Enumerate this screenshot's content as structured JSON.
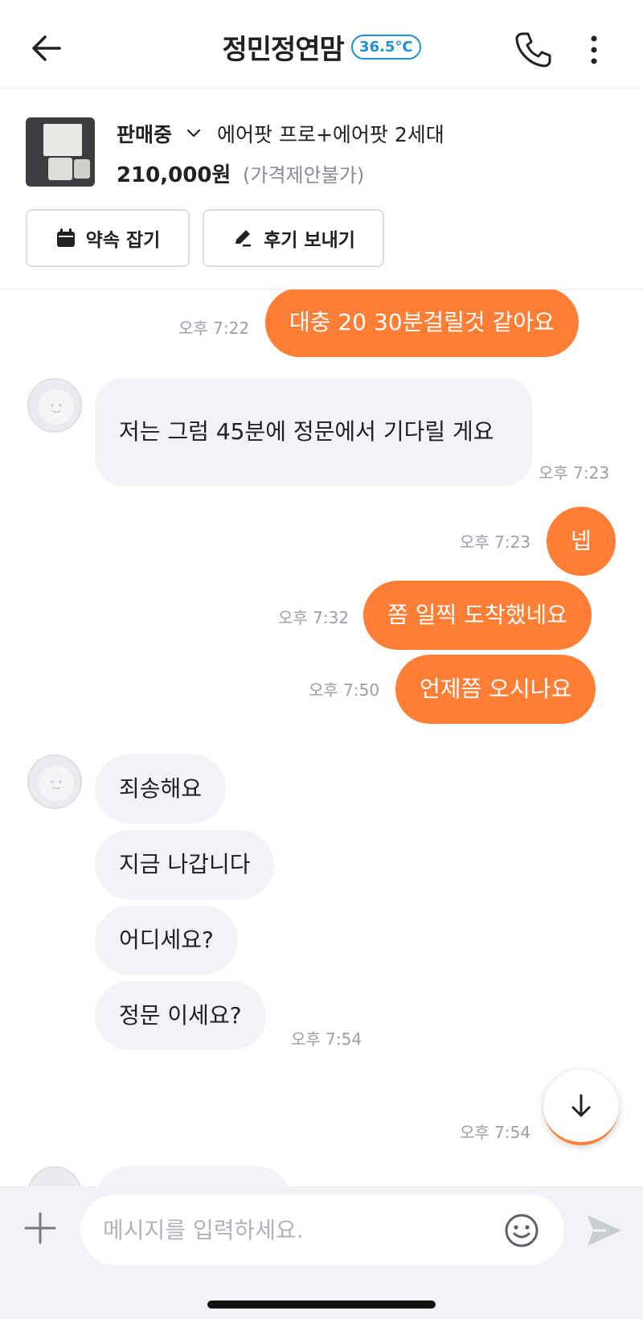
{
  "header": {
    "title": "정민정연맘",
    "temperature": "36.5°C",
    "icons": {
      "back": "back-arrow-icon",
      "phone": "phone-icon",
      "more": "more-vertical-icon"
    }
  },
  "product": {
    "status": "판매중",
    "title": "에어팟 프로+에어팟 2세대",
    "price": "210,000원",
    "price_note": "(가격제안불가)",
    "appointment_label": "약속 잡기",
    "review_label": "후기 보내기"
  },
  "messages": [
    {
      "from": "me",
      "text": "대충 20 30분걸릴것 같아요",
      "time": "오후 7:22"
    },
    {
      "from": "them",
      "text": "저는 그럼 45분에 정문에서 기다릴 게요",
      "time": "오후 7:23"
    },
    {
      "from": "me",
      "text": "넵",
      "time": "오후 7:23"
    },
    {
      "from": "me",
      "text": "쫌 일찍 도착했네요",
      "time": "오후 7:32"
    },
    {
      "from": "me",
      "text": "언제쯤 오시나요",
      "time": "오후 7:50"
    },
    {
      "from": "them",
      "text": "죄송해요",
      "time": ""
    },
    {
      "from": "them",
      "text": "지금 나갑니다",
      "time": ""
    },
    {
      "from": "them",
      "text": "어디세요?",
      "time": ""
    },
    {
      "from": "them",
      "text": "정문 이세요?",
      "time": "오후 7:54"
    },
    {
      "from": "me",
      "text": "",
      "time": "오후 7:54"
    }
  ],
  "input": {
    "placeholder": "메시지를 입력하세요."
  },
  "colors": {
    "accent": "#ff7e36",
    "temperature": "#1f8fd6",
    "bubble_other": "#f2f3f6"
  }
}
